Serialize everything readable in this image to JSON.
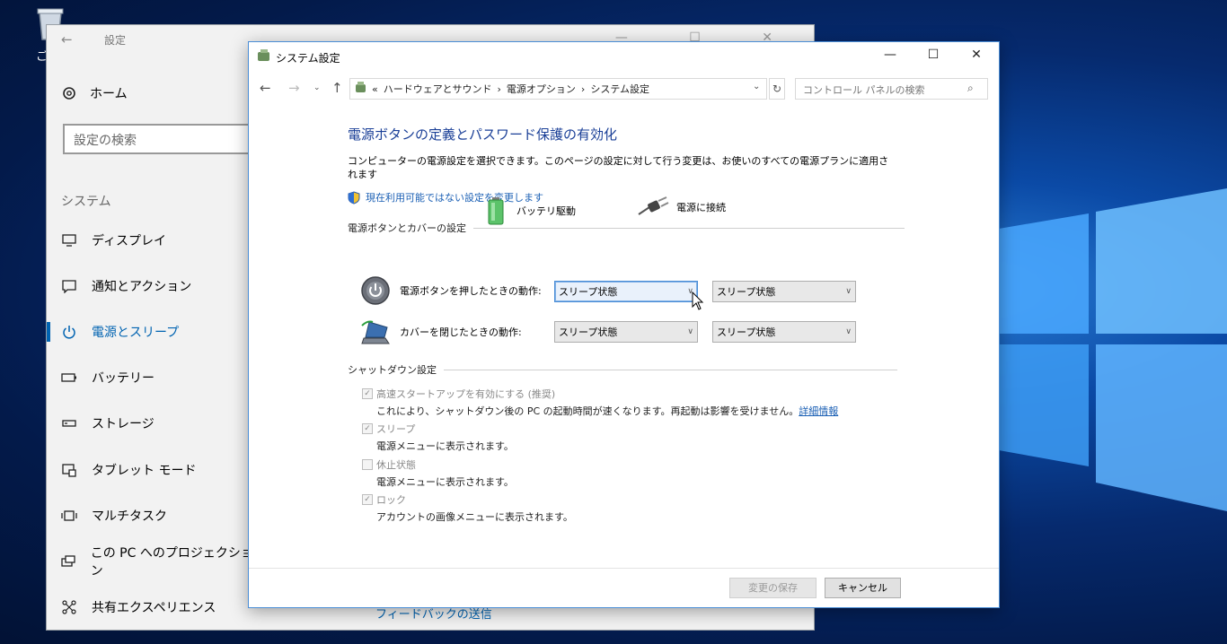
{
  "desktop": {
    "recycle_label": "ご"
  },
  "settings": {
    "title": "設定",
    "back_glyph": "←",
    "controls_glyph": "— ☐ ✕",
    "home": "ホーム",
    "search_placeholder": "設定の検索",
    "section": "システム",
    "nav": [
      {
        "label": "ディスプレイ"
      },
      {
        "label": "通知とアクション"
      },
      {
        "label": "電源とスリープ"
      },
      {
        "label": "バッテリー"
      },
      {
        "label": "ストレージ"
      },
      {
        "label": "タブレット モード"
      },
      {
        "label": "マルチタスク"
      },
      {
        "label": "この PC へのプロジェクション"
      },
      {
        "label": "共有エクスペリエンス"
      }
    ],
    "feedback": "フィードバックの送信"
  },
  "control_panel": {
    "title": "システム設定",
    "min_glyph": "—",
    "max_glyph": "☐",
    "close_glyph": "✕",
    "address": {
      "prefix": "«",
      "crumbs": [
        "ハードウェアとサウンド",
        "電源オプション",
        "システム設定"
      ],
      "sep": "›"
    },
    "search_placeholder": "コントロール パネルの検索",
    "heading": "電源ボタンの定義とパスワード保護の有効化",
    "description": "コンピューターの電源設定を選択できます。このページの設定に対して行う変更は、お使いのすべての電源プランに適用されます",
    "change_link": "現在利用可能ではない設定を変更します",
    "power_group": "電源ボタンとカバーの設定",
    "col_battery": "バッテリ駆動",
    "col_ac": "電源に接続",
    "rows": [
      {
        "label": "電源ボタンを押したときの動作:",
        "battery": "スリープ状態",
        "ac": "スリープ状態"
      },
      {
        "label": "カバーを閉じたときの動作:",
        "battery": "スリープ状態",
        "ac": "スリープ状態"
      }
    ],
    "shutdown_group": "シャットダウン設定",
    "options": [
      {
        "label": "高速スタートアップを有効にする (推奨)",
        "checked": true,
        "desc": "これにより、シャットダウン後の PC の起動時間が速くなります。再起動は影響を受けません。",
        "link": "詳細情報"
      },
      {
        "label": "スリープ",
        "checked": true,
        "desc": "電源メニューに表示されます。"
      },
      {
        "label": "休止状態",
        "checked": false,
        "desc": "電源メニューに表示されます。"
      },
      {
        "label": "ロック",
        "checked": true,
        "desc": "アカウントの画像メニューに表示されます。"
      }
    ],
    "save_button": "変更の保存",
    "cancel_button": "キャンセル",
    "check_glyph": "✓"
  }
}
